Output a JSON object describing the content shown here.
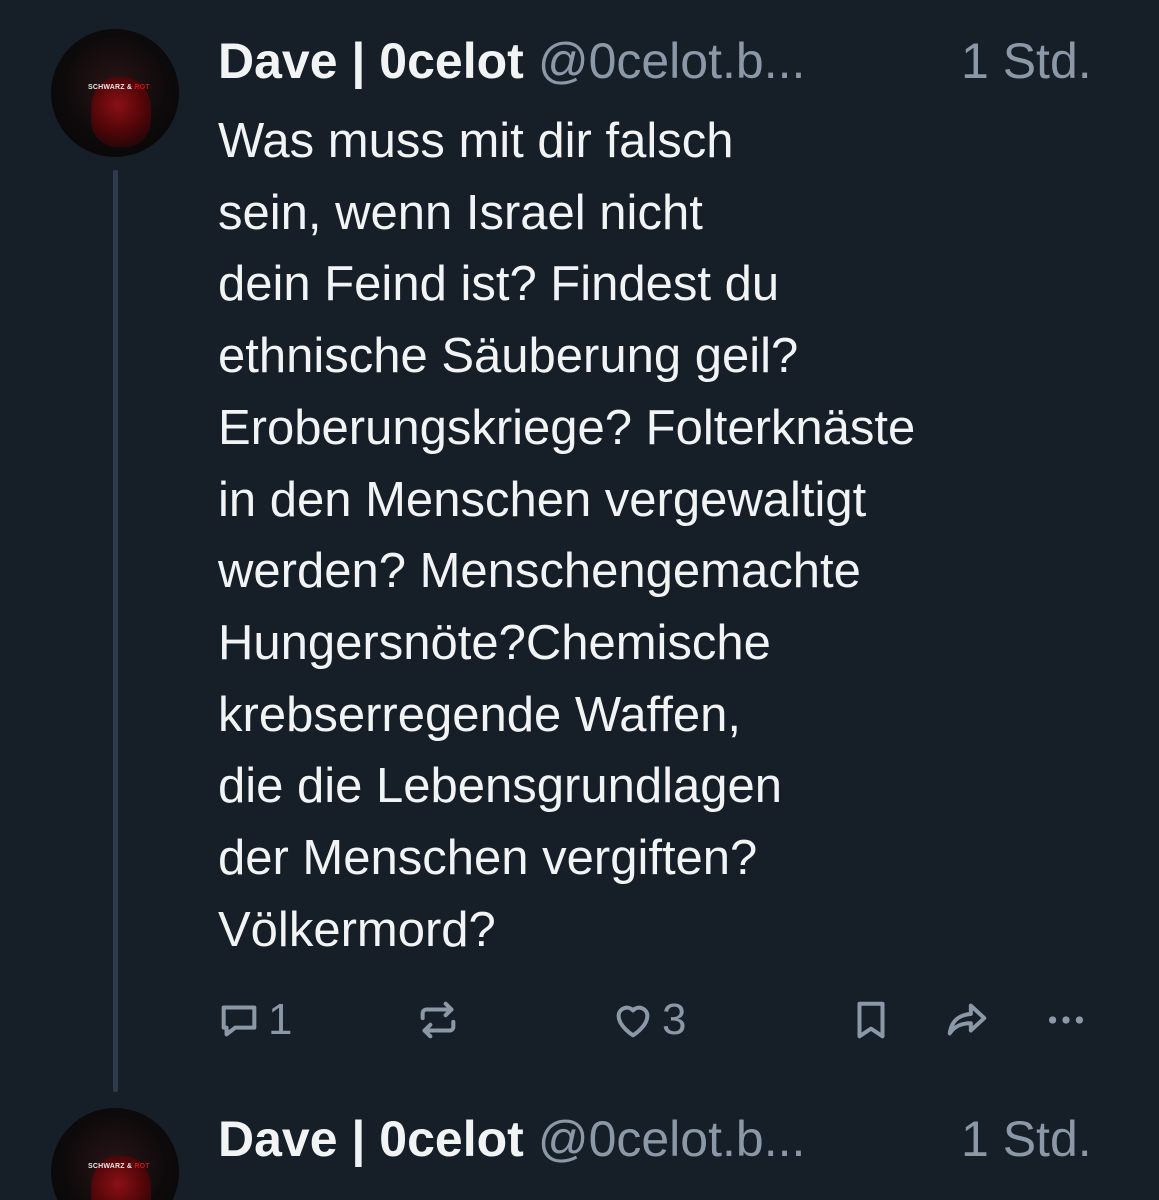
{
  "posts": [
    {
      "author_name": "Dave | 0celot",
      "handle": "@0celot.b...",
      "time": "1 Std.",
      "avatar_text_white": "SCHWARZ & ",
      "avatar_text_red": "ROT",
      "text": "Was muss mit dir falsch\nsein, wenn Israel nicht\ndein Feind ist? Findest du\nethnische Säuberung geil?\nEroberungskriege? Folterknäste\nin den Menschen vergewaltigt\nwerden? Menschengemachte\nHungersnöte?Chemische\nkrebserregende Waffen,\ndie die Lebensgrundlagen\nder Menschen vergiften?\nVölkermord?",
      "actions": {
        "reply_count": "1",
        "like_count": "3"
      }
    },
    {
      "author_name": "Dave | 0celot",
      "handle": "@0celot.b...",
      "time": "1 Std.",
      "avatar_text_white": "SCHWARZ & ",
      "avatar_text_red": "ROT"
    }
  ],
  "icons": {
    "reply": "speech-bubble-icon",
    "repost": "repost-arrows-icon",
    "like": "heart-icon",
    "bookmark": "bookmark-icon",
    "share": "share-arrow-icon",
    "more": "ellipsis-icon"
  },
  "colors": {
    "background": "#161e27",
    "text_primary": "#f1f3f5",
    "text_secondary": "#8b98a8",
    "thread_line": "#2d3b4b",
    "avatar_accent": "#c8161c"
  }
}
